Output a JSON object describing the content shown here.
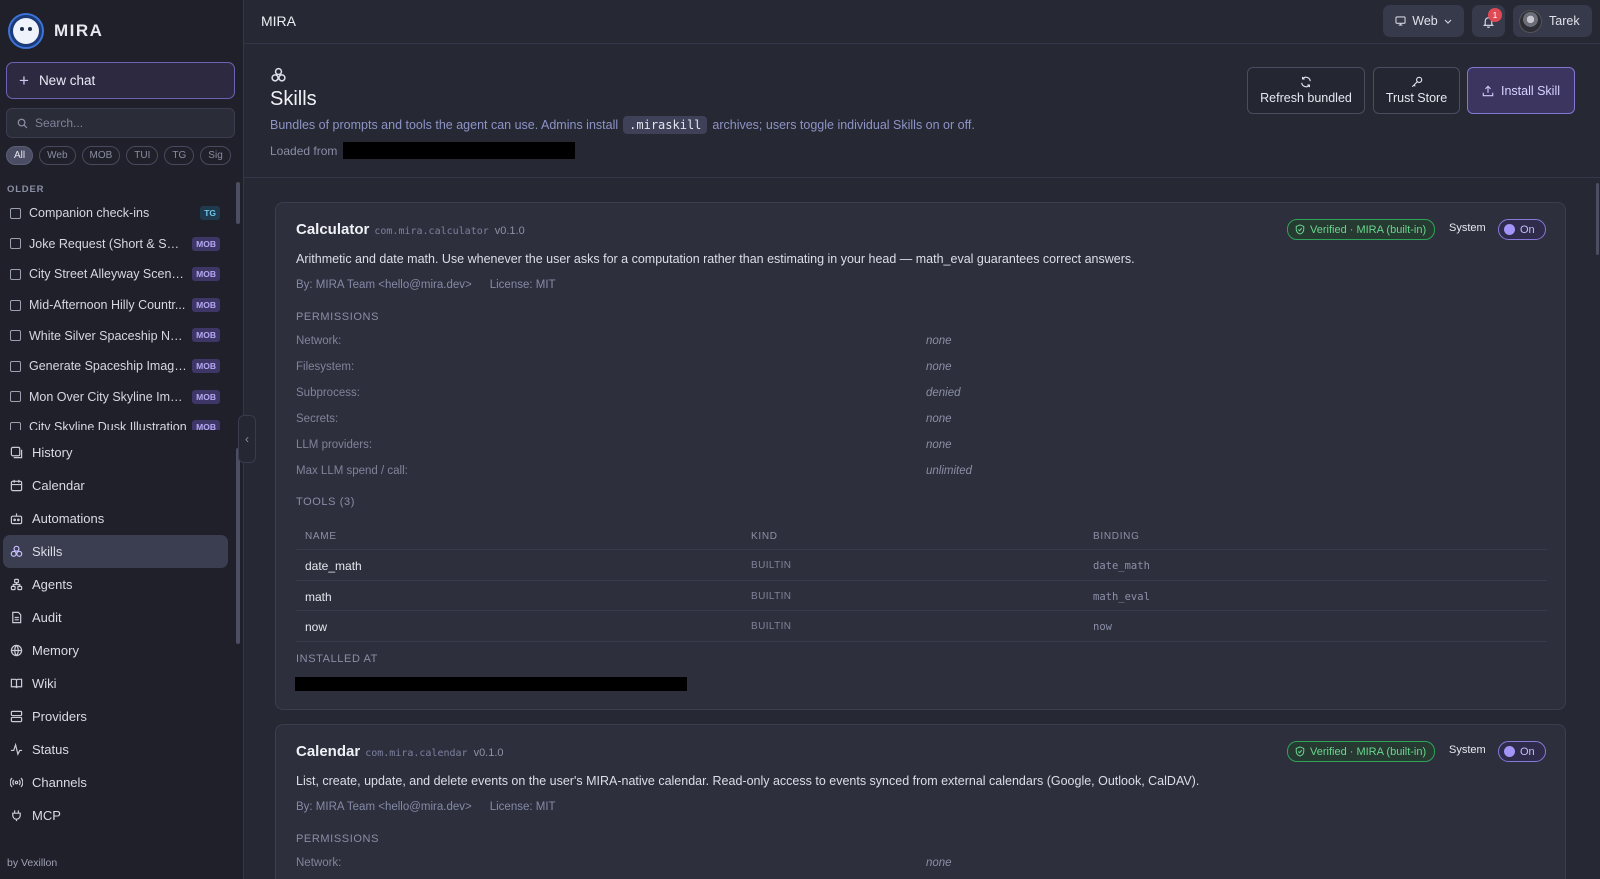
{
  "app": {
    "name": "MIRA",
    "footer": "by Vexillon"
  },
  "sidebar": {
    "new_chat": "New chat",
    "search_placeholder": "Search...",
    "filters": [
      "All",
      "Web",
      "MOB",
      "TUI",
      "TG",
      "Sig"
    ],
    "section_label": "OLDER",
    "chats": [
      {
        "title": "Companion check-ins",
        "tag": "TG"
      },
      {
        "title": "Joke Request (Short & Sweet)",
        "tag": "MOB"
      },
      {
        "title": "City Street Alleyway Scene (...",
        "tag": "MOB"
      },
      {
        "title": "Mid-Afternoon Hilly Countr...",
        "tag": "MOB"
      },
      {
        "title": "White Silver Spaceship Near...",
        "tag": "MOB"
      },
      {
        "title": "Generate Spaceship Image i...",
        "tag": "MOB"
      },
      {
        "title": "Mon Over City Skyline Imag...",
        "tag": "MOB"
      },
      {
        "title": "City Skyline Dusk Illustration",
        "tag": "MOB"
      }
    ],
    "nav": [
      {
        "label": "History",
        "icon": "history-icon"
      },
      {
        "label": "Calendar",
        "icon": "calendar-icon"
      },
      {
        "label": "Automations",
        "icon": "robot-icon"
      },
      {
        "label": "Skills",
        "icon": "skills-icon",
        "active": true
      },
      {
        "label": "Agents",
        "icon": "agents-icon"
      },
      {
        "label": "Audit",
        "icon": "audit-icon"
      },
      {
        "label": "Memory",
        "icon": "memory-icon"
      },
      {
        "label": "Wiki",
        "icon": "book-icon"
      },
      {
        "label": "Providers",
        "icon": "server-icon"
      },
      {
        "label": "Status",
        "icon": "activity-icon"
      },
      {
        "label": "Channels",
        "icon": "radio-icon"
      },
      {
        "label": "MCP",
        "icon": "plug-icon"
      }
    ]
  },
  "topbar": {
    "title": "MIRA",
    "env": "Web",
    "notifications": "1",
    "user": "Tarek"
  },
  "header": {
    "title": "Skills",
    "desc_before": "Bundles of prompts and tools the agent can use. Admins install",
    "desc_code": ".miraskill",
    "desc_after": "archives; users toggle individual Skills on or off.",
    "loaded_from": "Loaded from",
    "buttons": {
      "refresh": "Refresh bundled",
      "trust": "Trust Store",
      "install": "Install Skill"
    }
  },
  "skills": [
    {
      "name": "Calculator",
      "id": "com.mira.calculator",
      "version": "v0.1.0",
      "verified": "Verified · MIRA (built-in)",
      "system": "System",
      "toggle": "On",
      "description": "Arithmetic and date math. Use whenever the user asks for a computation rather than estimating in your head — math_eval guarantees correct answers.",
      "by": "By: MIRA Team <hello@mira.dev>",
      "license": "License: MIT",
      "permissions_label": "PERMISSIONS",
      "permissions": [
        {
          "k": "Network:",
          "v": "none"
        },
        {
          "k": "Filesystem:",
          "v": "none"
        },
        {
          "k": "Subprocess:",
          "v": "denied"
        },
        {
          "k": "Secrets:",
          "v": "none"
        },
        {
          "k": "LLM providers:",
          "v": "none"
        },
        {
          "k": "Max LLM spend / call:",
          "v": "unlimited"
        }
      ],
      "tools_label": "TOOLS (3)",
      "tool_headers": [
        "NAME",
        "KIND",
        "BINDING"
      ],
      "tools": [
        {
          "name": "date_math",
          "kind": "BUILTIN",
          "binding": "date_math"
        },
        {
          "name": "math",
          "kind": "BUILTIN",
          "binding": "math_eval"
        },
        {
          "name": "now",
          "kind": "BUILTIN",
          "binding": "now"
        }
      ],
      "installed_label": "INSTALLED AT"
    },
    {
      "name": "Calendar",
      "id": "com.mira.calendar",
      "version": "v0.1.0",
      "verified": "Verified · MIRA (built-in)",
      "system": "System",
      "toggle": "On",
      "description": "List, create, update, and delete events on the user's MIRA-native calendar. Read-only access to events synced from external calendars (Google, Outlook, CalDAV).",
      "by": "By: MIRA Team <hello@mira.dev>",
      "license": "License: MIT",
      "permissions_label": "PERMISSIONS",
      "permissions": [
        {
          "k": "Network:",
          "v": "none"
        }
      ]
    }
  ]
}
